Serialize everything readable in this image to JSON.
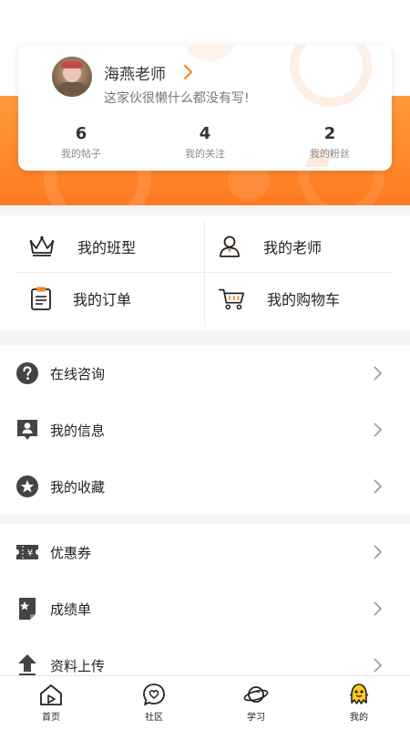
{
  "profile": {
    "name": "海燕老师",
    "bio": "这家伙很懒什么都没有写!",
    "stats": [
      {
        "value": "6",
        "label": "我的帖子"
      },
      {
        "value": "4",
        "label": "我的关注"
      },
      {
        "value": "2",
        "label": "我的粉丝"
      }
    ]
  },
  "quick_links": [
    {
      "label": "我的班型",
      "icon": "crown-icon"
    },
    {
      "label": "我的老师",
      "icon": "teacher-icon"
    },
    {
      "label": "我的订单",
      "icon": "clipboard-icon"
    },
    {
      "label": "我的购物车",
      "icon": "cart-icon"
    }
  ],
  "menu_group_1": [
    {
      "label": "在线咨询",
      "icon": "question-circle-icon"
    },
    {
      "label": "我的信息",
      "icon": "user-message-icon"
    },
    {
      "label": "我的收藏",
      "icon": "star-circle-icon"
    }
  ],
  "menu_group_2": [
    {
      "label": "优惠券",
      "icon": "coupon-icon"
    },
    {
      "label": "成绩单",
      "icon": "report-icon"
    },
    {
      "label": "资料上传",
      "icon": "upload-icon"
    }
  ],
  "tabs": [
    {
      "label": "首页",
      "icon": "home-icon"
    },
    {
      "label": "社区",
      "icon": "community-icon"
    },
    {
      "label": "学习",
      "icon": "planet-icon"
    },
    {
      "label": "我的",
      "icon": "mascot-icon"
    }
  ],
  "colors": {
    "accent": "#ff7d25",
    "arrow": "#e8892e"
  }
}
